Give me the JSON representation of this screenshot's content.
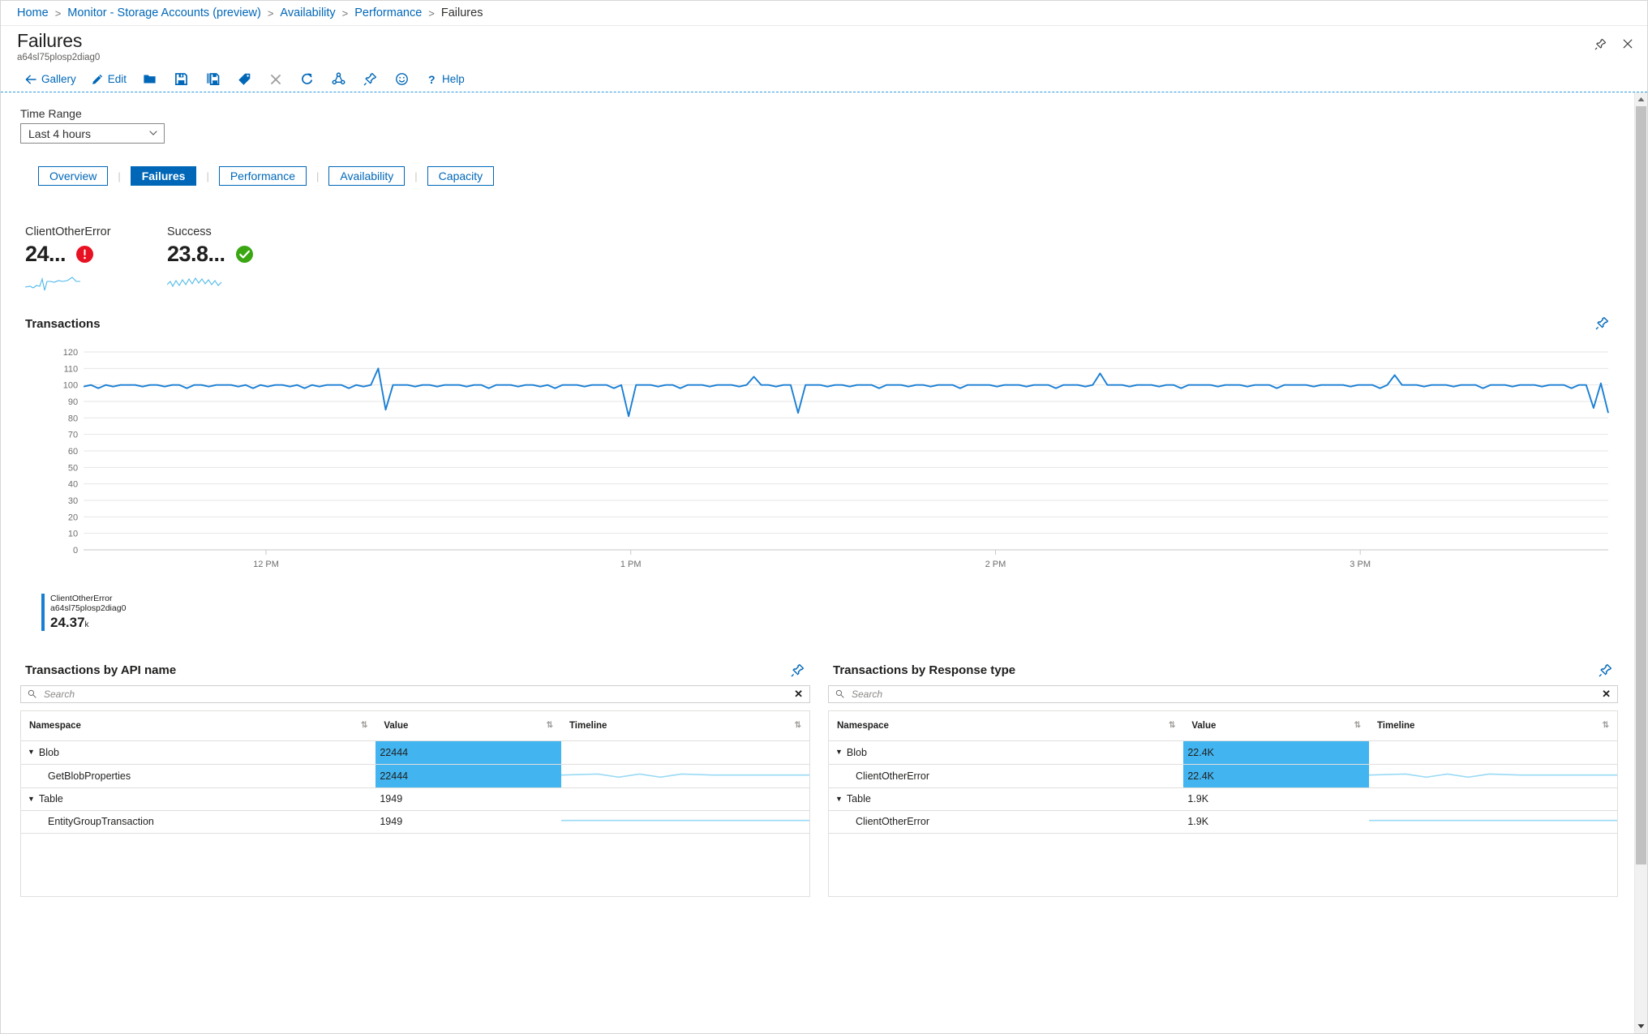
{
  "breadcrumb": {
    "items": [
      {
        "label": "Home",
        "link": true
      },
      {
        "label": "Monitor - Storage Accounts (preview)",
        "link": true
      },
      {
        "label": "Availability",
        "link": true
      },
      {
        "label": "Performance",
        "link": true
      },
      {
        "label": "Failures",
        "link": false
      }
    ],
    "separator": ">"
  },
  "header": {
    "title": "Failures",
    "subtitle": "a64sl75plosp2diag0",
    "pin_icon": "pin-icon",
    "close_icon": "close-icon"
  },
  "toolbar": {
    "items": [
      {
        "label": "Gallery",
        "icon": "back-arrow-icon",
        "muted": false
      },
      {
        "label": "Edit",
        "icon": "pencil-icon",
        "muted": false
      },
      {
        "label": "",
        "icon": "open-folder-icon",
        "muted": false
      },
      {
        "label": "",
        "icon": "save-icon",
        "muted": false
      },
      {
        "label": "",
        "icon": "save-as-icon",
        "muted": false
      },
      {
        "label": "",
        "icon": "tag-icon",
        "muted": false
      },
      {
        "label": "",
        "icon": "delete-x-icon",
        "muted": true
      },
      {
        "label": "",
        "icon": "refresh-icon",
        "muted": false
      },
      {
        "label": "",
        "icon": "share-icon",
        "muted": false
      },
      {
        "label": "",
        "icon": "pin-icon",
        "muted": false
      },
      {
        "label": "",
        "icon": "feedback-smiley-icon",
        "muted": false
      },
      {
        "label": "Help",
        "icon": "question-mark-icon",
        "muted": false
      }
    ]
  },
  "time_range": {
    "label": "Time Range",
    "value": "Last 4 hours",
    "chevron": "chevron-down-icon"
  },
  "tabs": [
    {
      "label": "Overview",
      "active": false
    },
    {
      "label": "Failures",
      "active": true
    },
    {
      "label": "Performance",
      "active": false
    },
    {
      "label": "Availability",
      "active": false
    },
    {
      "label": "Capacity",
      "active": false
    }
  ],
  "tab_divider": "|",
  "kpis": [
    {
      "title": "ClientOtherError",
      "value": "24...",
      "status": "error",
      "status_icon": "error-exclamation-icon",
      "color": "#e81123"
    },
    {
      "title": "Success",
      "value": "23.8...",
      "status": "ok",
      "status_icon": "success-check-icon",
      "color": "#3aa612"
    }
  ],
  "chart_panel": {
    "title": "Transactions",
    "pin_icon": "pin-icon",
    "legend": {
      "name": "ClientOtherError",
      "resource": "a64sl75plosp2diag0",
      "value": "24.37",
      "unit": "k",
      "swatch": "#1a7fd4"
    }
  },
  "chart_data": {
    "type": "line",
    "title": "Transactions",
    "xlabel": "",
    "ylabel": "",
    "ylim": [
      0,
      120
    ],
    "yticks": [
      120,
      110,
      100,
      90,
      80,
      70,
      60,
      50,
      40,
      30,
      20,
      10,
      0
    ],
    "xticks": [
      "12 PM",
      "1 PM",
      "2 PM",
      "3 PM"
    ],
    "grid": true,
    "legend_position": "below",
    "series": [
      {
        "name": "ClientOtherError",
        "resource": "a64sl75plosp2diag0",
        "color": "#1a7fd4",
        "total": 24370,
        "total_label": "24.37 k",
        "values": [
          99,
          100,
          98,
          100,
          99,
          100,
          100,
          100,
          99,
          100,
          100,
          99,
          100,
          100,
          98,
          100,
          100,
          99,
          100,
          100,
          100,
          99,
          100,
          98,
          100,
          99,
          100,
          100,
          99,
          100,
          98,
          100,
          99,
          100,
          100,
          100,
          98,
          100,
          99,
          100,
          110,
          85,
          100,
          100,
          100,
          99,
          100,
          100,
          99,
          100,
          100,
          100,
          99,
          100,
          100,
          98,
          100,
          100,
          100,
          99,
          100,
          100,
          99,
          100,
          98,
          100,
          100,
          100,
          99,
          100,
          100,
          100,
          98,
          100,
          81,
          100,
          100,
          100,
          99,
          100,
          100,
          98,
          100,
          100,
          100,
          99,
          100,
          100,
          100,
          99,
          100,
          105,
          100,
          100,
          99,
          100,
          100,
          83,
          100,
          100,
          100,
          99,
          100,
          100,
          99,
          100,
          100,
          100,
          98,
          100,
          100,
          100,
          99,
          100,
          100,
          99,
          100,
          100,
          100,
          98,
          100,
          100,
          100,
          100,
          99,
          100,
          100,
          100,
          99,
          100,
          100,
          100,
          98,
          100,
          100,
          100,
          99,
          100,
          107,
          100,
          100,
          100,
          99,
          100,
          100,
          100,
          99,
          100,
          100,
          98,
          100,
          100,
          100,
          100,
          99,
          100,
          100,
          100,
          99,
          100,
          100,
          100,
          98,
          100,
          100,
          100,
          100,
          99,
          100,
          100,
          100,
          100,
          99,
          100,
          100,
          100,
          98,
          100,
          106,
          100,
          100,
          100,
          99,
          100,
          100,
          100,
          99,
          100,
          100,
          100,
          98,
          100,
          100,
          100,
          99,
          100,
          100,
          100,
          99,
          100,
          100,
          100,
          98,
          100,
          100,
          86,
          101,
          83
        ]
      }
    ]
  },
  "grids": [
    {
      "title": "Transactions by API name",
      "pin_icon": "pin-icon",
      "search": {
        "placeholder": "Search",
        "value": "",
        "icon": "search-icon",
        "clear": "✕"
      },
      "columns": [
        {
          "label": "Namespace",
          "sort": "sort-arrows-icon"
        },
        {
          "label": "Value",
          "sort": "sort-arrows-icon"
        },
        {
          "label": "Timeline",
          "sort": "sort-arrows-icon"
        }
      ],
      "rows": [
        {
          "name": "Blob",
          "level": "group",
          "caret": "▼",
          "value": "22444",
          "bar_pct": 100,
          "bar": true,
          "timeline": false
        },
        {
          "name": "GetBlobProperties",
          "level": "child",
          "value": "22444",
          "bar_pct": 100,
          "bar": true,
          "timeline": true
        },
        {
          "name": "Table",
          "level": "group",
          "caret": "▼",
          "value": "1949",
          "bar_pct": 0,
          "bar": false,
          "timeline": false
        },
        {
          "name": "EntityGroupTransaction",
          "level": "child",
          "value": "1949",
          "bar_pct": 0,
          "bar": false,
          "timeline": true
        }
      ]
    },
    {
      "title": "Transactions by Response type",
      "pin_icon": "pin-icon",
      "search": {
        "placeholder": "Search",
        "value": "",
        "icon": "search-icon",
        "clear": "✕"
      },
      "columns": [
        {
          "label": "Namespace",
          "sort": "sort-arrows-icon"
        },
        {
          "label": "Value",
          "sort": "sort-arrows-icon"
        },
        {
          "label": "Timeline",
          "sort": "sort-arrows-icon"
        }
      ],
      "rows": [
        {
          "name": "Blob",
          "level": "group",
          "caret": "▼",
          "value": "22.4K",
          "bar_pct": 100,
          "bar": true,
          "timeline": false
        },
        {
          "name": "ClientOtherError",
          "level": "child",
          "value": "22.4K",
          "bar_pct": 100,
          "bar": true,
          "timeline": true
        },
        {
          "name": "Table",
          "level": "group",
          "caret": "▼",
          "value": "1.9K",
          "bar_pct": 0,
          "bar": false,
          "timeline": false
        },
        {
          "name": "ClientOtherError",
          "level": "child",
          "value": "1.9K",
          "bar_pct": 0,
          "bar": false,
          "timeline": true
        }
      ]
    }
  ],
  "scrollbar": {
    "up": "scroll-up-arrow-icon",
    "down": "scroll-down-arrow-icon"
  },
  "colors": {
    "accent": "#0067b8",
    "bar": "#42b4f0",
    "line": "#1a7fd4",
    "error": "#e81123",
    "success": "#3aa612"
  }
}
